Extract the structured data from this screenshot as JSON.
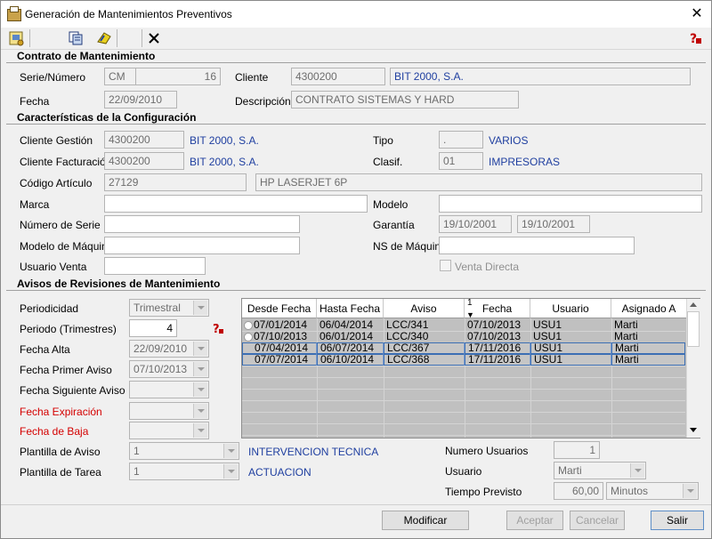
{
  "window": {
    "title": "Generación de Mantenimientos Preventivos"
  },
  "toolbar": {
    "icons": [
      "config-icon",
      "copy-icon",
      "refresh-icon",
      "delete-icon",
      "help-icon"
    ]
  },
  "contrato": {
    "title": "Contrato de Mantenimiento",
    "serie_label": "Serie/Número",
    "serie": "CM",
    "numero": "16",
    "cliente_label": "Cliente",
    "cliente_code": "4300200",
    "cliente_name": "BIT 2000, S.A.",
    "fecha_label": "Fecha",
    "fecha": "22/09/2010",
    "descripcion_label": "Descripción",
    "descripcion": "CONTRATO SISTEMAS Y HARD"
  },
  "config": {
    "title": "Características de la Configuración",
    "cliente_gestion_label": "Cliente Gestión",
    "cliente_gestion_code": "4300200",
    "cliente_gestion_name": "BIT 2000, S.A.",
    "cliente_fact_label": "Cliente Facturación",
    "cliente_fact_code": "4300200",
    "cliente_fact_name": "BIT 2000, S.A.",
    "tipo_label": "Tipo",
    "tipo_code": ".",
    "tipo_name": "VARIOS",
    "clasif_label": "Clasif.",
    "clasif_code": "01",
    "clasif_name": "IMPRESORAS",
    "codigo_label": "Código Artículo",
    "codigo": "27129",
    "codigo_desc": "HP LASERJET 6P",
    "marca_label": "Marca",
    "marca": "",
    "modelo_label": "Modelo",
    "modelo": "",
    "num_serie_label": "Número de Serie",
    "num_serie": "",
    "garantia_label": "Garantía",
    "garantia_desde": "19/10/2001",
    "garantia_hasta": "19/10/2001",
    "modelo_maquina_label": "Modelo de Máquina",
    "modelo_maquina": "",
    "ns_maquina_label": "NS de Máquina",
    "ns_maquina": "",
    "usuario_venta_label": "Usuario Venta",
    "usuario_venta": "",
    "venta_directa_label": "Venta Directa"
  },
  "avisos": {
    "title": "Avisos de Revisiones de Mantenimiento",
    "periodicidad_label": "Periodicidad",
    "periodicidad": "Trimestral",
    "periodo_label": "Periodo (Trimestres)",
    "periodo": "4",
    "fecha_alta_label": "Fecha Alta",
    "fecha_alta": "22/09/2010",
    "fecha_primer_label": "Fecha Primer Aviso",
    "fecha_primer": "07/10/2013",
    "fecha_siguiente_label": "Fecha Siguiente Aviso",
    "fecha_siguiente": "",
    "fecha_expiracion_label": "Fecha Expiración",
    "fecha_expiracion": "",
    "fecha_baja_label": "Fecha de Baja",
    "fecha_baja": "",
    "plantilla_aviso_label": "Plantilla de Aviso",
    "plantilla_aviso": "1",
    "plantilla_aviso_name": "INTERVENCION TECNICA",
    "plantilla_tarea_label": "Plantilla de Tarea",
    "plantilla_tarea": "1",
    "plantilla_tarea_name": "ACTUACION",
    "num_usuarios_label": "Numero Usuarios",
    "num_usuarios": "1",
    "usuario_label": "Usuario",
    "usuario": "Marti",
    "tiempo_label": "Tiempo Previsto",
    "tiempo": "60,00",
    "tiempo_unidad": "Minutos"
  },
  "grid": {
    "headers": [
      "Desde Fecha",
      "Hasta Fecha",
      "Aviso",
      "Fecha",
      "Usuario",
      "Asignado A"
    ],
    "sort_indicator": "1",
    "rows": [
      [
        "07/01/2014",
        "06/04/2014",
        "LCC/341",
        "07/10/2013",
        "USU1",
        "Marti"
      ],
      [
        "07/10/2013",
        "06/01/2014",
        "LCC/340",
        "07/10/2013",
        "USU1",
        "Marti"
      ],
      [
        "07/04/2014",
        "06/07/2014",
        "LCC/367",
        "17/11/2016",
        "USU1",
        "Marti"
      ],
      [
        "07/07/2014",
        "06/10/2014",
        "LCC/368",
        "17/11/2016",
        "USU1",
        "Marti"
      ]
    ]
  },
  "buttons": {
    "modificar": "Modificar",
    "aceptar": "Aceptar",
    "cancelar": "Cancelar",
    "salir": "Salir"
  }
}
